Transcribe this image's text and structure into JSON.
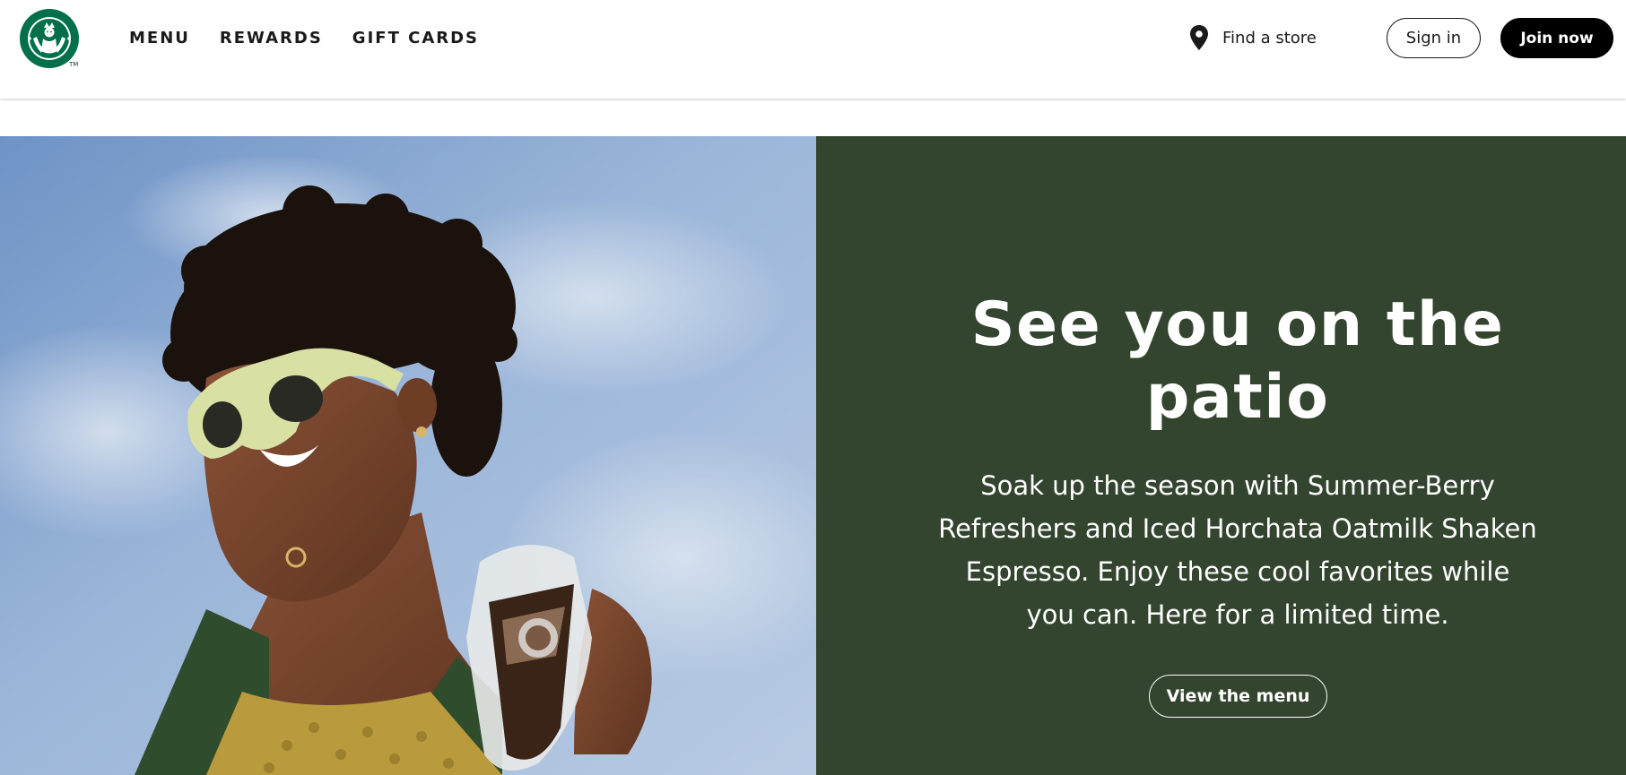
{
  "header": {
    "logo_icon": "starbucks-siren-logo",
    "trademark": "TM",
    "nav": [
      {
        "label": "MENU"
      },
      {
        "label": "REWARDS"
      },
      {
        "label": "GIFT CARDS"
      }
    ],
    "find_store": {
      "icon": "location-pin-icon",
      "label": "Find a store"
    },
    "sign_in_label": "Sign in",
    "join_now_label": "Join now"
  },
  "hero": {
    "image_subject": "person-with-sunglasses-holding-iced-coffee",
    "title": "See you on the patio",
    "body": "Soak up the season with Summer-Berry Refreshers and Iced Horchata Oatmilk Shaken Espresso. Enjoy these cool favorites while you can. Here for a limited time.",
    "cta_label": "View the menu"
  },
  "colors": {
    "brand_green": "#00704a",
    "panel_green": "#33452f",
    "text_dark": "#1a1a1a",
    "button_black": "#000000",
    "white": "#ffffff"
  }
}
